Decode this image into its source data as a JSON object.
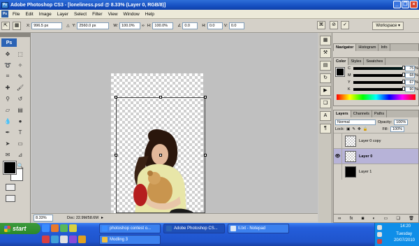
{
  "window": {
    "title": "Adobe Photoshop CS3 - [loneliness.psd @ 8.33% (Layer 0, RGB/8)]",
    "app_icon": "Ps",
    "controls": [
      "minimize-icon",
      "restore-icon",
      "close-icon"
    ]
  },
  "menu": {
    "logo": "Ps",
    "items": [
      "File",
      "Edit",
      "Image",
      "Layer",
      "Select",
      "Filter",
      "View",
      "Window",
      "Help"
    ]
  },
  "options": {
    "x_label": "X:",
    "x_value": "996.5 px",
    "y_label": "Y:",
    "y_value": "2560.0 px",
    "w_label": "W:",
    "w_value": "100.0%",
    "h_label": "H:",
    "h_value": "100.0%",
    "angle_value": "0.0",
    "hskew_label": "H:",
    "hskew_value": "0.0",
    "vskew_label": "V:",
    "vskew_value": "0.0",
    "workspace": "Workspace ▾"
  },
  "toolbox": {
    "logo": "Ps",
    "tools": [
      "move-tool-icon",
      "marquee-tool-icon",
      "lasso-tool-icon",
      "magic-wand-icon",
      "crop-tool-icon",
      "slice-tool-icon",
      "healing-brush-icon",
      "brush-tool-icon",
      "clone-stamp-icon",
      "history-brush-icon",
      "eraser-icon",
      "gradient-icon",
      "blur-tool-icon",
      "dodge-tool-icon",
      "pen-tool-icon",
      "type-tool-icon",
      "path-select-icon",
      "shape-tool-icon",
      "notes-icon",
      "eyedropper-icon",
      "hand-tool-icon",
      "zoom-tool-icon"
    ],
    "foreground_color": "#000000",
    "background_color": "#ffffff"
  },
  "status": {
    "zoom": "8.33%",
    "doc": "Doc: 22.9M/58.6M"
  },
  "panels": {
    "navigator_tabs": [
      "Navigator",
      "Histogram",
      "Info"
    ],
    "color_tabs": [
      "Color",
      "Styles",
      "Swatches"
    ],
    "cmyk": [
      {
        "label": "C",
        "value": "75"
      },
      {
        "label": "M",
        "value": "68"
      },
      {
        "label": "Y",
        "value": "67"
      },
      {
        "label": "K",
        "value": "90"
      }
    ],
    "percent_sign": "%",
    "layers_tabs": [
      "Layers",
      "Channels",
      "Paths"
    ],
    "blend_mode": "Normal",
    "opacity_label": "Opacity:",
    "opacity_value": "100%",
    "lock_label": "Lock:",
    "fill_label": "Fill:",
    "fill_value": "100%",
    "layers": [
      {
        "name": "Layer 0 copy",
        "visible": false,
        "thumb": "checker"
      },
      {
        "name": "Layer 0",
        "visible": true,
        "thumb": "checker",
        "selected": true
      },
      {
        "name": "Layer 1",
        "visible": false,
        "thumb": "black"
      }
    ]
  },
  "taskbar": {
    "start_label": "start",
    "tasks": [
      {
        "label": "photoshop contest o...",
        "active": false
      },
      {
        "label": "Adobe Photoshop CS...",
        "active": true
      },
      {
        "label": "ti.txt - Notepad",
        "active": false
      },
      {
        "label": "Modling 3",
        "active": false
      }
    ],
    "time": "14:20",
    "day": "Tuesday",
    "date": "20/07/2010"
  }
}
